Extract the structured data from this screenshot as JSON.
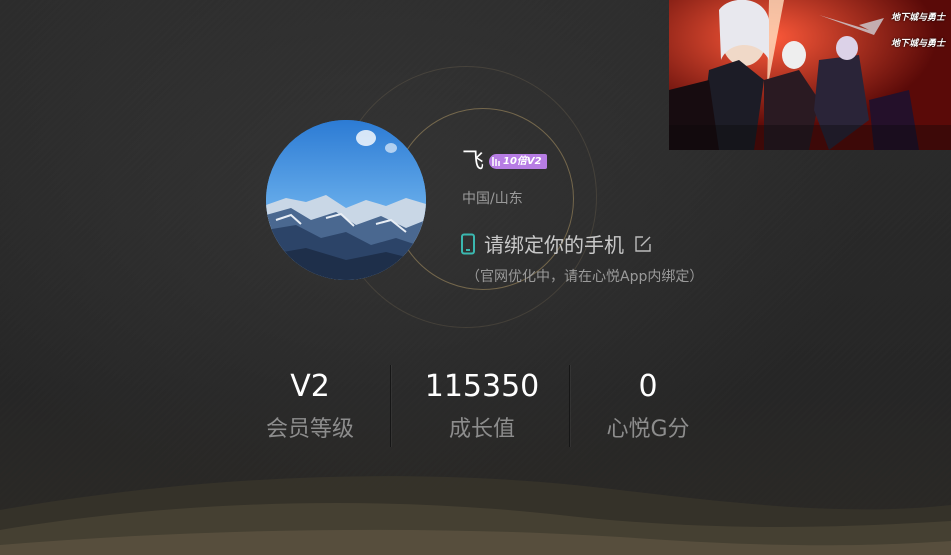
{
  "profile": {
    "nickname": "飞",
    "vip_badge": "10倍V2",
    "location": "中国/山东",
    "bind_phone_label": "请绑定你的手机",
    "bind_phone_note": "（官网优化中，请在心悦App内绑定）"
  },
  "stats": [
    {
      "value": "V2",
      "label": "会员等级"
    },
    {
      "value": "115350",
      "label": "成长值"
    },
    {
      "value": "0",
      "label": "心悦G分"
    }
  ],
  "promo": {
    "logo_1": "地下城与勇士",
    "logo_2": "地下城与勇士"
  },
  "colors": {
    "badge": "#b77de4",
    "phone_icon": "#3bb8b0",
    "background": "#2b2b2b"
  }
}
